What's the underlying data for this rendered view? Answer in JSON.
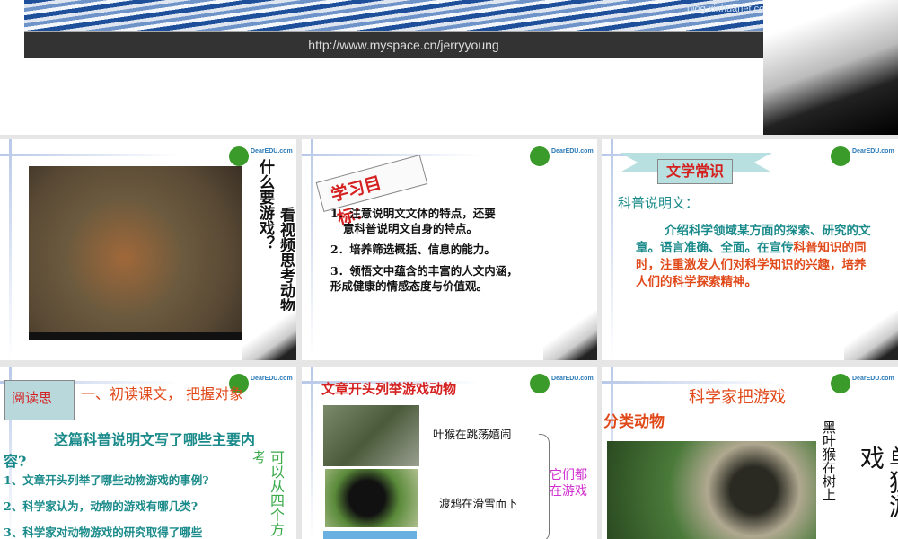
{
  "top_slide": {
    "url": "http://www.myspace.cn/jerryyoung",
    "watermark": "blog.xinhuanet.com"
  },
  "logo": "DearEDU.com",
  "slide1": {
    "vertical_1": "什么要游戏？",
    "vertical_2": "看视频思考动物为"
  },
  "slide2": {
    "title": "学习目标：",
    "items": [
      "1．注意说明文文体的特点，还要",
      "意科普说明文自身的特点。",
      "2．培养筛选概括、信息的能力。",
      "3．领悟文中蕴含的丰富的人文内涵，",
      "形成健康的情感态度与价值观。"
    ]
  },
  "slide3": {
    "banner": "文学常识",
    "heading": "科普说明文：",
    "body_teal": "介绍科学领域某方面的探索、研究的文章。语言准确、全面。在宣传",
    "body_red": "科普知识的同时，注重激发人们对科学知识的兴趣，培养人们的科学探索精神。"
  },
  "slide4": {
    "flag": "阅读思",
    "title": "一、初读课文， 把握对象",
    "question": "这篇科普说明文写了哪些主要内容?",
    "items": [
      "1、文章开头列举了哪些动物游戏的事例?",
      "2、科学家认为，动物的游戏有哪几类?",
      "3、科学家对动物游戏的研究取得了哪些"
    ],
    "side_1": "考",
    "side_2": "可以从四个方"
  },
  "slide5": {
    "title": "文章开头列举游戏动物",
    "captions": [
      "叶猴在跳荡嬉闹",
      "渡鸦在滑雪而下"
    ],
    "brace_label": "它们都在游戏"
  },
  "slide6": {
    "title": "科学家把游戏",
    "subtitle": "分类动物",
    "vertical_small": "黑叶猴在树上",
    "vertical_big": "单独游戏"
  }
}
